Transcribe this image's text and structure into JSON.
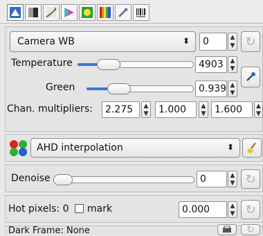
{
  "tabs": [
    {
      "icon": "exposure-icon",
      "active": true
    },
    {
      "icon": "color-swatch-icon",
      "active": false
    },
    {
      "icon": "curves-icon",
      "active": false
    },
    {
      "icon": "color-triangle-icon",
      "active": false
    },
    {
      "icon": "lens-icon",
      "active": false
    },
    {
      "icon": "rainbow-icon",
      "active": false
    },
    {
      "icon": "tools-icon",
      "active": false
    },
    {
      "icon": "barcode-icon",
      "active": false
    }
  ],
  "wb": {
    "preset": "Camera WB",
    "preset_spin": "0",
    "temperature_label": "Temperature",
    "temperature_value": "4903",
    "green_label": "Green",
    "green_value": "0.939",
    "chan_label": "Chan. multipliers:",
    "chan_r": "2.275",
    "chan_g": "1.000",
    "chan_b": "1.600"
  },
  "demosaic": {
    "method": "AHD interpolation"
  },
  "denoise": {
    "label": "Denoise",
    "value": "0"
  },
  "hotpixels": {
    "label": "Hot pixels: 0",
    "mark_label": "mark",
    "value": "0.000"
  },
  "darkframe": {
    "label": "Dark Frame: None"
  },
  "colors": {
    "accent": "#3a76d8",
    "background": "#e9e9e9"
  }
}
